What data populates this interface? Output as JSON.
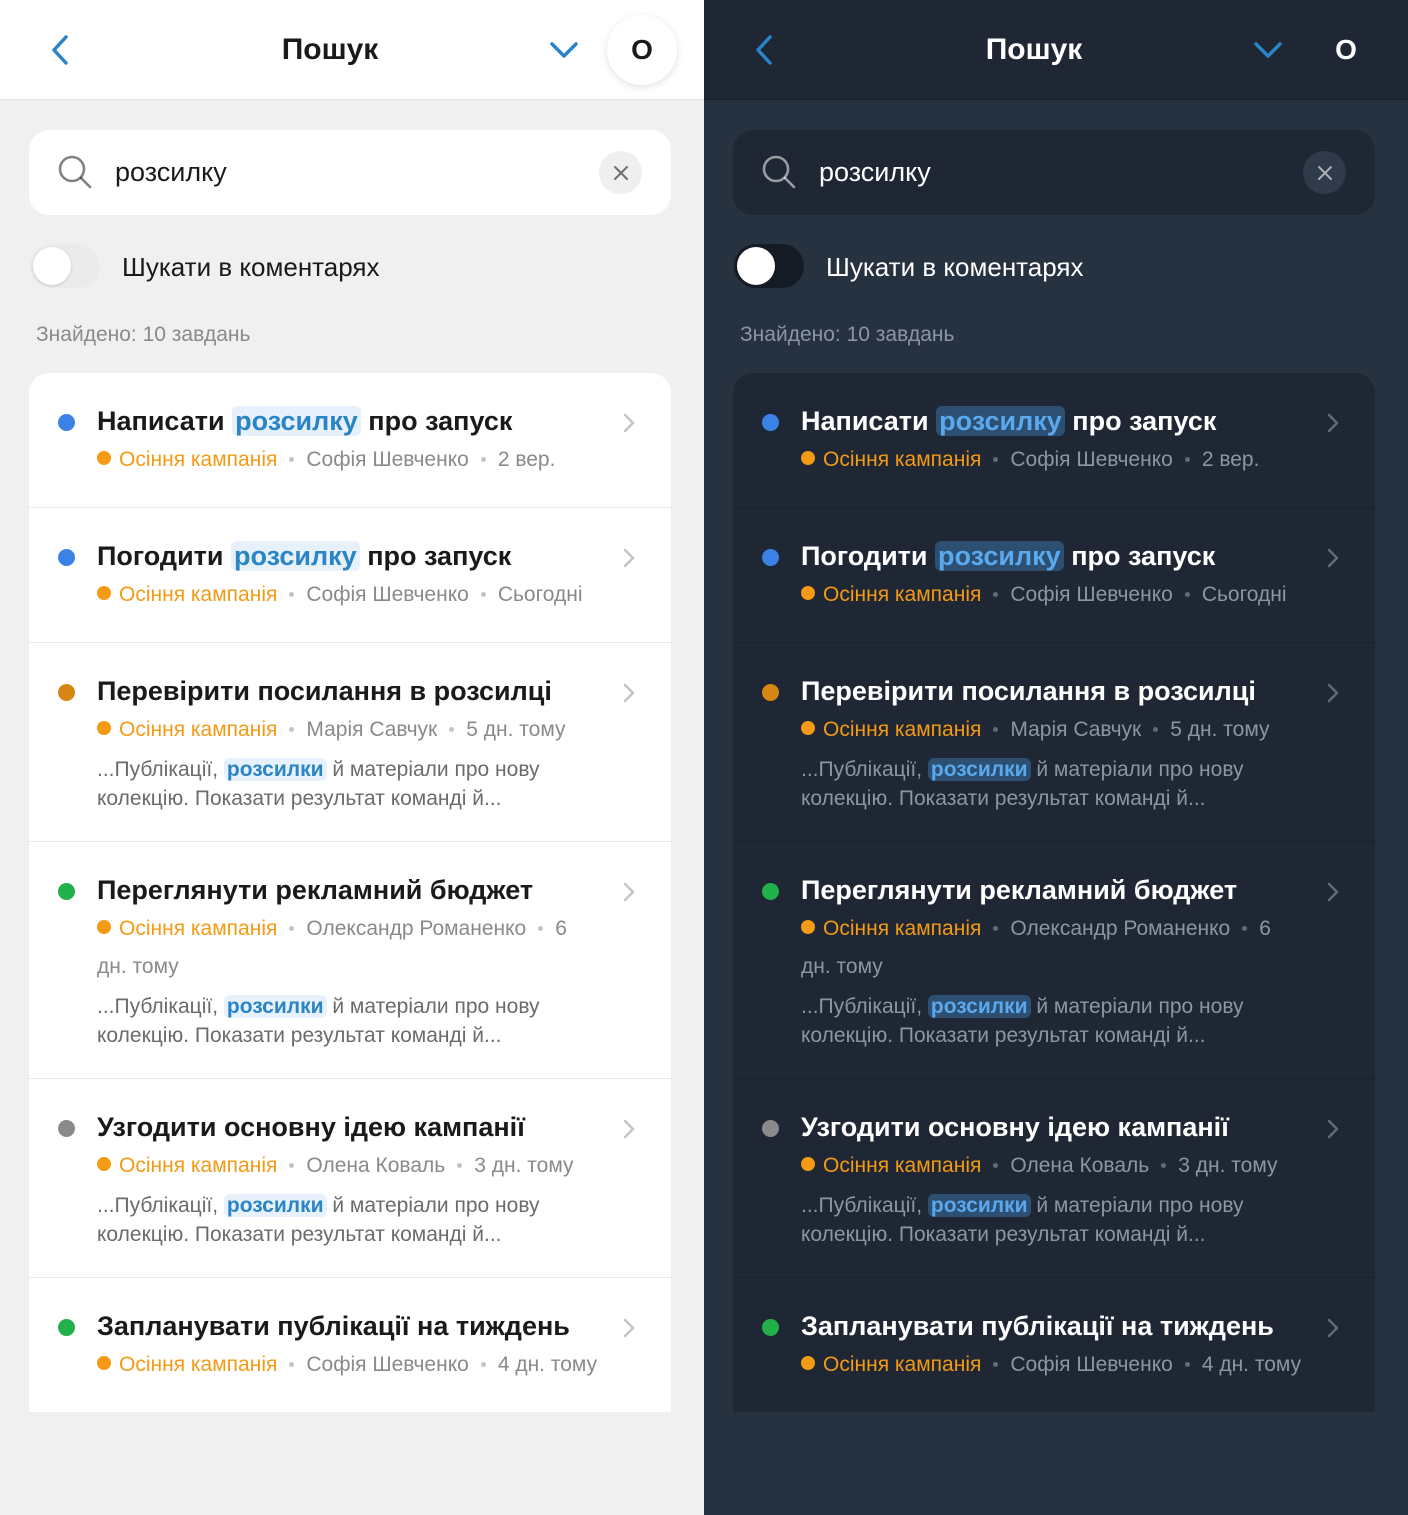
{
  "header": {
    "title": "Пошук",
    "avatar_initial": "О"
  },
  "search": {
    "value": "розсилку",
    "placeholder": ""
  },
  "toggle": {
    "label": "Шукати в коментарях",
    "on": false
  },
  "results_count": "Знайдено: 10 завдань",
  "colors": {
    "accent": "#2a84c6",
    "project": "#f49a14",
    "blue": "#3b82e6",
    "orange": "#d68612",
    "green": "#22b04b",
    "gray": "#8a8a8a"
  },
  "tasks": [
    {
      "status_color": "#3b82e6",
      "title_before": "Написати ",
      "title_highlight": "розсилку",
      "title_after": " про запуск",
      "project": "Осіння кампанія",
      "assignee": "Софія Шевченко",
      "date": "2 вер.",
      "snippet": null
    },
    {
      "status_color": "#3b82e6",
      "title_before": "Погодити ",
      "title_highlight": "розсилку",
      "title_after": " про запуск",
      "project": "Осіння кампанія",
      "assignee": "Софія Шевченко",
      "date": "Сьогодні",
      "snippet": null
    },
    {
      "status_color": "#d68612",
      "title_before": "Перевірити посилання в розсилці",
      "title_highlight": "",
      "title_after": "",
      "project": "Осіння кампанія",
      "assignee": "Марія Савчук",
      "date": "5 дн. тому",
      "snippet": {
        "before": "...Публікації, ",
        "highlight": "розсилки",
        "after": " й матеріали про нову колекцію. Показати результат команді й..."
      }
    },
    {
      "status_color": "#22b04b",
      "title_before": "Переглянути рекламний бюджет",
      "title_highlight": "",
      "title_after": "",
      "project": "Осіння кампанія",
      "assignee": "Олександр Романенко",
      "date": "6 дн. тому",
      "snippet": {
        "before": "...Публікації, ",
        "highlight": "розсилки",
        "after": " й матеріали про нову колекцію. Показати результат команді й..."
      }
    },
    {
      "status_color": "#8a8a8a",
      "title_before": "Узгодити основну ідею кампанії",
      "title_highlight": "",
      "title_after": "",
      "project": "Осіння кампанія",
      "assignee": "Олена Коваль",
      "date": "3 дн. тому",
      "snippet": {
        "before": "...Публікації, ",
        "highlight": "розсилки",
        "after": " й матеріали про нову колекцію. Показати результат команді й..."
      }
    },
    {
      "status_color": "#22b04b",
      "title_before": "Запланувати публікації на тиждень",
      "title_highlight": "",
      "title_after": "",
      "project": "Осіння кампанія",
      "assignee": "Софія Шевченко",
      "date": "4 дн. тому",
      "snippet": null
    }
  ]
}
